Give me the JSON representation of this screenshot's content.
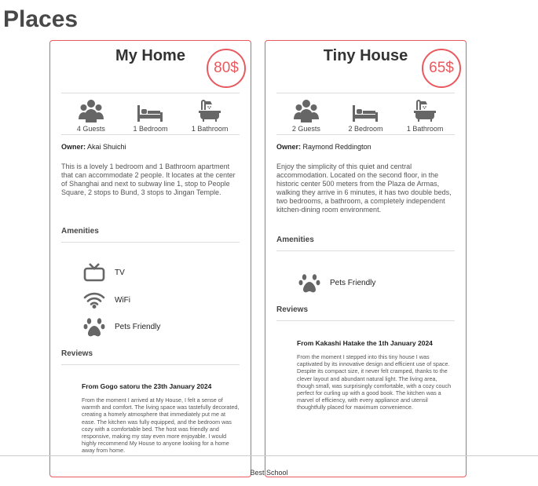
{
  "page": {
    "title": "Places"
  },
  "places": [
    {
      "name": "My Home",
      "price": "80$",
      "guests": "4 Guests",
      "bedrooms": "1 Bedroom",
      "bathrooms": "1 Bathroom",
      "owner_label": "Owner:",
      "owner": "Akai Shuichi",
      "description": "This is a lovely 1 bedroom and 1 Bathroom apartment that can accommodate 2 people. It locates at the center of Shanghai and next to subway line 1, stop to People Square, 2 stops to Bund, 3 stops to Jingan Temple.",
      "amenities_heading": "Amenities",
      "amenities": [
        {
          "icon": "tv-icon",
          "label": "TV"
        },
        {
          "icon": "wifi-icon",
          "label": "WiFi"
        },
        {
          "icon": "paw-icon",
          "label": "Pets Friendly"
        }
      ],
      "reviews_heading": "Reviews",
      "review": {
        "title": "From Gogo satoru the 23th January 2024",
        "text": "From the moment I arrived at My House, I felt a sense of warmth and comfort. The living space was tastefully decorated, creating a homely atmosphere that immediately put me at ease. The kitchen was fully equipped, and the bedroom was cozy with a comfortable bed. The host was friendly and responsive, making my stay even more enjoyable. I would highly recommend My House to anyone looking for a home away from home."
      }
    },
    {
      "name": "Tiny House",
      "price": "65$",
      "guests": "2 Guests",
      "bedrooms": "2 Bedroom",
      "bathrooms": "1 Bathroom",
      "owner_label": "Owner:",
      "owner": "Raymond Reddington",
      "description": "Enjoy the simplicity of this quiet and central accommodation. Located on the second floor, in the historic center 500 meters from the Plaza de Armas, walking they arrive in 6 minutes, it has two double beds, two bedrooms, a bathroom, a completely independent kitchen-dining room environment.",
      "amenities_heading": "Amenities",
      "amenities": [
        {
          "icon": "paw-icon",
          "label": "Pets Friendly"
        }
      ],
      "reviews_heading": "Reviews",
      "review": {
        "title": "From Kakashi Hatake the 1th January 2024",
        "text": "From the moment I stepped into this tiny house I was captivated by its innovative design and efficient use of space. Despite its compact size, it never felt cramped, thanks to the clever layout and abundant natural light. The living area, though small, was surprisingly comfortable, with a cozy couch perfect for curling up with a good book. The kitchen was a marvel of efficiency, with every appliance and utensil thoughtfully placed for maximum convenience."
      }
    }
  ],
  "footer": {
    "text": "Best School"
  },
  "colors": {
    "accent": "#e85a5f",
    "icon": "#666666"
  }
}
